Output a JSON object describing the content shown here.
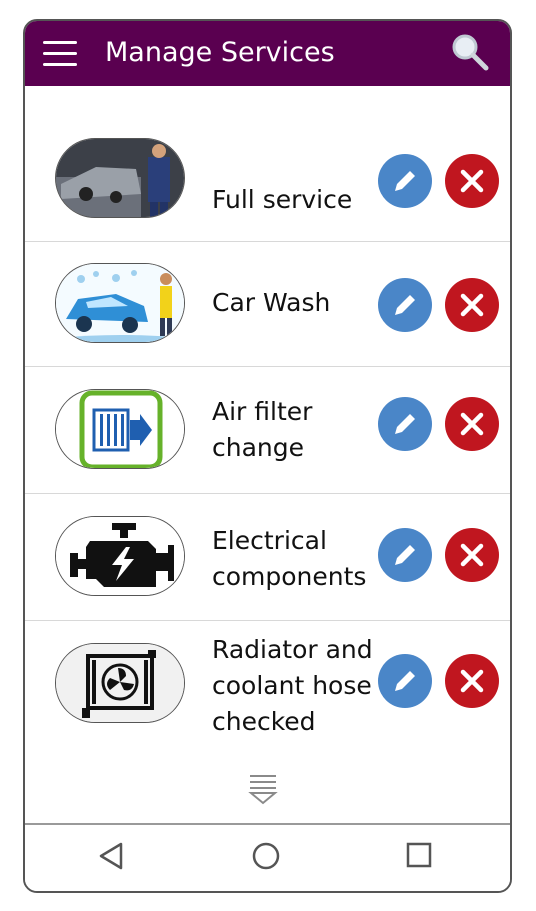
{
  "app": {
    "title": "Manage Services"
  },
  "colors": {
    "appbar": "#5a0050",
    "edit": "#4a86c8",
    "delete": "#c0161f"
  },
  "icons": {
    "menu": "hamburger-menu-icon",
    "search": "magnifier-icon",
    "edit": "pencil-icon",
    "delete": "x-close-icon",
    "more": "chevron-down-lines-icon",
    "nav_back": "triangle-back-icon",
    "nav_home": "circle-home-icon",
    "nav_recent": "square-recents-icon"
  },
  "services": [
    {
      "label": "Full service",
      "image": "mechanic-repairing-car-photo"
    },
    {
      "label": "Car Wash",
      "image": "car-wash-illustration"
    },
    {
      "label": "Air filter change",
      "image": "air-filter-icon"
    },
    {
      "label": "Electrical components",
      "image": "engine-electrical-icon"
    },
    {
      "label": "Radiator and coolant hose checked",
      "image": "radiator-fan-icon"
    }
  ]
}
